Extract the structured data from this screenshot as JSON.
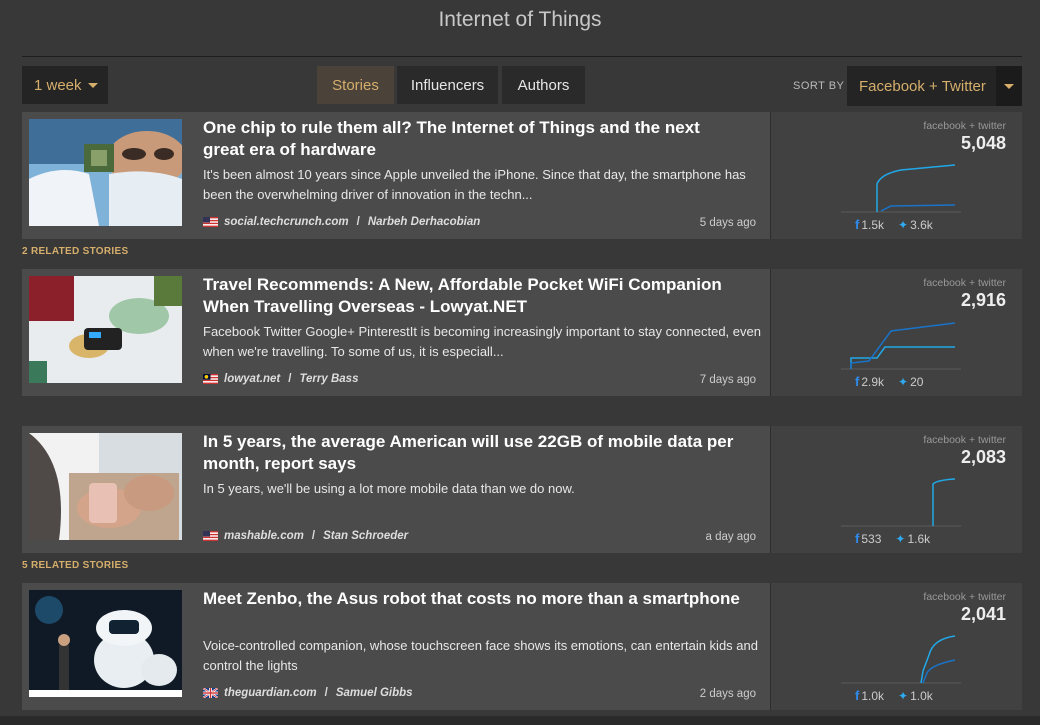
{
  "header": {
    "title": "Internet of Things"
  },
  "filters": {
    "period": "1 week",
    "tabs": [
      {
        "label": "Stories",
        "active": true
      },
      {
        "label": "Influencers",
        "active": false
      },
      {
        "label": "Authors",
        "active": false
      }
    ],
    "sort_label": "SORT BY",
    "sort_value": "Facebook + Twitter"
  },
  "stories": [
    {
      "title": "One chip to rule them all? The Internet of Things and the next great era of hardware",
      "excerpt": "It's been almost 10 years since Apple unveiled the iPhone. Since that day, the smartphone has been the overwhelming driver of innovation in the techn...",
      "domain": "social.techcrunch.com",
      "author": "Narbeh Derhacobian",
      "country": "US",
      "time": "5 days ago",
      "metric_label": "facebook + twitter",
      "total": "5,048",
      "facebook": "1.5k",
      "twitter": "3.6k",
      "related": "2 RELATED STORIES"
    },
    {
      "title": "Travel Recommends: A New, Affordable Pocket WiFi Companion When Travelling Overseas - Lowyat.NET",
      "excerpt": "Facebook Twitter Google+ PinterestIt is becoming increasingly important to stay connected, even when we're travelling. To some of us, it is especiall...",
      "domain": "lowyat.net",
      "author": "Terry Bass",
      "country": "MY",
      "time": "7 days ago",
      "metric_label": "facebook + twitter",
      "total": "2,916",
      "facebook": "2.9k",
      "twitter": "20",
      "related": ""
    },
    {
      "title": "In 5 years, the average American will use 22GB of mobile data per month, report says",
      "excerpt": "In 5 years, we'll be using a lot more mobile data than we do now.",
      "domain": "mashable.com",
      "author": "Stan Schroeder",
      "country": "US",
      "time": "a day ago",
      "metric_label": "facebook + twitter",
      "total": "2,083",
      "facebook": "533",
      "twitter": "1.6k",
      "related": "5 RELATED STORIES"
    },
    {
      "title": "Meet Zenbo, the Asus robot that costs no more than a smartphone",
      "excerpt": "Voice-controlled companion, whose touchscreen face shows its emotions, can entertain kids and control the lights",
      "domain": "theguardian.com",
      "author": "Samuel Gibbs",
      "country": "GB",
      "time": "2 days ago",
      "metric_label": "facebook + twitter",
      "total": "2,041",
      "facebook": "1.0k",
      "twitter": "1.0k",
      "related": ""
    }
  ],
  "colors": {
    "accent": "#d5ae6c",
    "facebook": "#2e8cf0",
    "twitter": "#2eaaf0",
    "sparkline_bright": "#21a8e8",
    "sparkline_dark": "#1a73c8"
  }
}
